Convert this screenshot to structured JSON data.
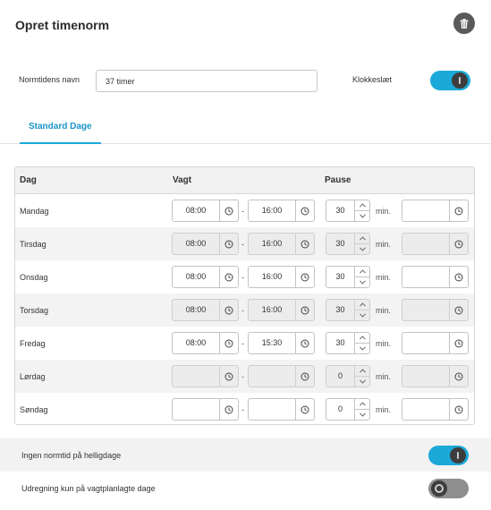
{
  "header": {
    "title": "Opret timenorm",
    "delete_icon": "trash-icon"
  },
  "form": {
    "name_label": "Normtidens navn",
    "name_value": "37 timer",
    "clock_label": "Klokkeslæt",
    "clock_enabled": true
  },
  "tabs": [
    {
      "label": "Standard Dage",
      "active": true
    }
  ],
  "table": {
    "headers": {
      "day": "Dag",
      "shift": "Vagt",
      "pause": "Pause"
    },
    "separator": "-",
    "unit": "min.",
    "rows": [
      {
        "day": "Mandag",
        "start": "08:00",
        "end": "16:00",
        "pause": "30",
        "disabled": false
      },
      {
        "day": "Tirsdag",
        "start": "08:00",
        "end": "16:00",
        "pause": "30",
        "disabled": true
      },
      {
        "day": "Onsdag",
        "start": "08:00",
        "end": "16:00",
        "pause": "30",
        "disabled": false
      },
      {
        "day": "Torsdag",
        "start": "08:00",
        "end": "16:00",
        "pause": "30",
        "disabled": true
      },
      {
        "day": "Fredag",
        "start": "08:00",
        "end": "15:30",
        "pause": "30",
        "disabled": false
      },
      {
        "day": "Lørdag",
        "start": "",
        "end": "",
        "pause": "0",
        "disabled": true
      },
      {
        "day": "Søndag",
        "start": "",
        "end": "",
        "pause": "0",
        "disabled": false
      }
    ]
  },
  "options": [
    {
      "label": "Ingen normtid på helligdage",
      "enabled": true
    },
    {
      "label": "Udregning kun på vagtplanlagte dage",
      "enabled": false
    }
  ],
  "colors": {
    "accent": "#1ba9d9",
    "toggle_off": "#8e8e8e",
    "trash_bg": "#5a5a5a"
  }
}
